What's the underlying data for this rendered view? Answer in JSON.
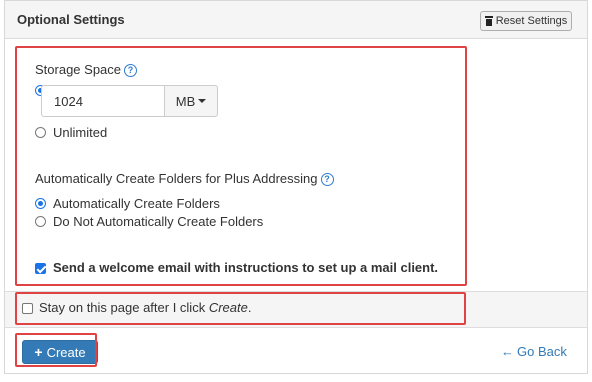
{
  "panel": {
    "title": "Optional Settings",
    "reset_label": "Reset Settings"
  },
  "storage": {
    "title": "Storage Space",
    "quota_value": "1024",
    "unit_label": "MB",
    "unlimited_label": "Unlimited"
  },
  "folders": {
    "title": "Automatically Create Folders for Plus Addressing",
    "option_auto": "Automatically Create Folders",
    "option_manual": "Do Not Automatically Create Folders"
  },
  "welcome": {
    "label": "Send a welcome email with instructions to set up a mail client."
  },
  "stay": {
    "prefix": "Stay on this page after I click ",
    "emphasis": "Create",
    "suffix": "."
  },
  "footer": {
    "create_label": "Create",
    "goback_label": "Go Back"
  },
  "colors": {
    "accent": "#337ab7",
    "highlight_box": "#e04343",
    "check_blue": "#1a73e8"
  },
  "icons": {
    "reset": "trash-icon",
    "help": "question-circle-icon",
    "create": "plus-icon",
    "back": "arrow-left-icon"
  }
}
